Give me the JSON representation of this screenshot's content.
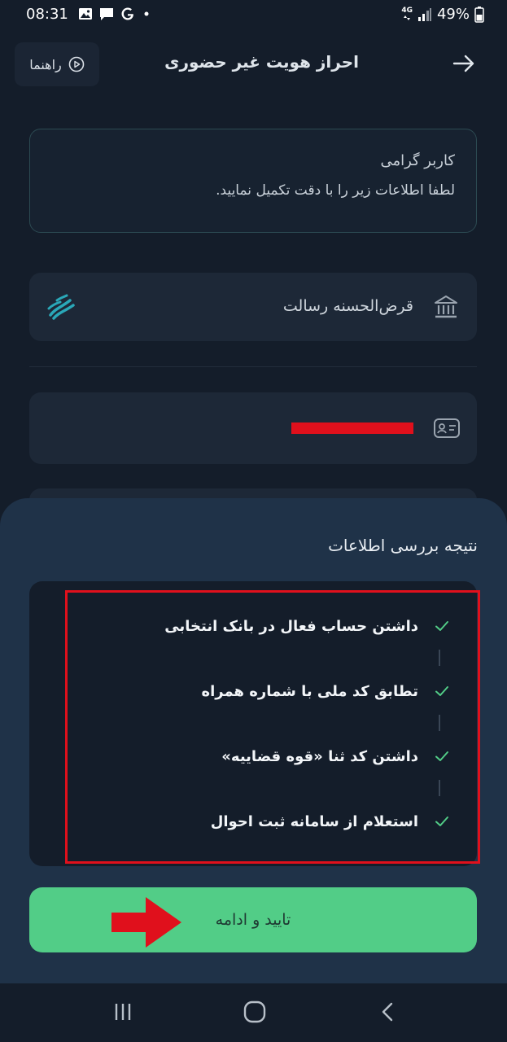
{
  "status_bar": {
    "time": "08:31",
    "notification_icons": [
      "image-icon",
      "message-icon",
      "google-icon",
      "dot-icon"
    ],
    "network_type": "4G",
    "battery_percent": "49%"
  },
  "header": {
    "help_label": "راهنما",
    "title": "احراز هویت غیر حضوری",
    "back_icon": "arrow-right-icon"
  },
  "info_card": {
    "title": "کاربر گرامی",
    "subtitle": "لطفا اطلاعات زیر را با دقت تکمیل نمایید."
  },
  "bank": {
    "name": "قرض‌الحسنه رسالت",
    "icon": "bank-icon",
    "logo": "resalat-logo"
  },
  "national_id": {
    "icon": "id-card-icon",
    "value_redacted": true
  },
  "result_sheet": {
    "title": "نتیجه بررسی اطلاعات",
    "checks": [
      {
        "label": "داشتن حساب فعال در بانک انتخابی",
        "status": "passed"
      },
      {
        "label": "تطابق کد ملی با شماره همراه",
        "status": "passed"
      },
      {
        "label": "داشتن کد ثنا «قوه قضاییه»",
        "status": "passed"
      },
      {
        "label": "استعلام از سامانه ثبت احوال",
        "status": "passed"
      }
    ],
    "continue_label": "تایید و ادامه"
  },
  "colors": {
    "background": "#141d2a",
    "sheet": "#1f3248",
    "accent_green": "#52cd87",
    "annotation_red": "#e0101c"
  },
  "nav_bar": {
    "recent_icon": "recent-apps-icon",
    "home_icon": "home-icon",
    "back_icon": "back-chevron-icon"
  }
}
